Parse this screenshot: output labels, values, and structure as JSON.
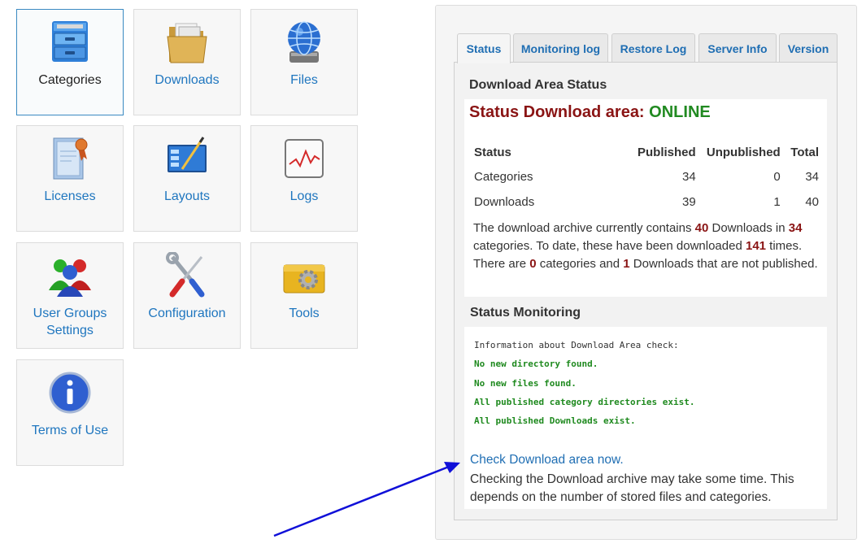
{
  "tiles": [
    {
      "label": "Categories",
      "icon": "file-cabinet-icon",
      "active": true
    },
    {
      "label": "Downloads",
      "icon": "folder-documents-icon"
    },
    {
      "label": "Files",
      "icon": "globe-drive-icon"
    },
    {
      "label": "Licenses",
      "icon": "certificate-icon"
    },
    {
      "label": "Layouts",
      "icon": "layout-window-icon"
    },
    {
      "label": "Logs",
      "icon": "chart-log-icon"
    },
    {
      "label": "User Groups Settings",
      "icon": "user-group-icon"
    },
    {
      "label": "Configuration",
      "icon": "wrench-screwdriver-icon"
    },
    {
      "label": "Tools",
      "icon": "gear-toolbox-icon"
    },
    {
      "label": "Terms of Use",
      "icon": "info-icon"
    }
  ],
  "tabs": [
    {
      "label": "Status",
      "active": true
    },
    {
      "label": "Monitoring log"
    },
    {
      "label": "Restore Log"
    },
    {
      "label": "Server Info"
    },
    {
      "label": "Version"
    }
  ],
  "status": {
    "section_title": "Download Area Status",
    "status_prefix": "Status Download area:",
    "status_value": "ONLINE",
    "table": {
      "headers": [
        "Status",
        "Published",
        "Unpublished",
        "Total"
      ],
      "rows": [
        [
          "Categories",
          "34",
          "0",
          "34"
        ],
        [
          "Downloads",
          "39",
          "1",
          "40"
        ]
      ]
    },
    "summary": {
      "t1": "The download archive currently contains ",
      "n_downloads": "40",
      "t2": " Downloads in ",
      "n_categories": "34",
      "t3": " categories. To date, these have been downloaded ",
      "n_times": "141",
      "t4": " times. There are ",
      "n_unpub_cat": "0",
      "t5": " categories and ",
      "n_unpub_dl": "1",
      "t6": " Downloads that are not published."
    }
  },
  "monitoring": {
    "section_title": "Status Monitoring",
    "info": "Information about Download Area check:",
    "lines": [
      "No new directory found.",
      "No new files found.",
      "All published category directories exist.",
      "All published Downloads exist."
    ],
    "check_link": "Check Download area now.",
    "note": "Checking the Download archive may take some time. This depends on the number of stored files and categories."
  },
  "colors": {
    "link": "#1f6eb3",
    "online": "#218a21",
    "status_red": "#8a1414",
    "arrow": "#1010d8"
  }
}
